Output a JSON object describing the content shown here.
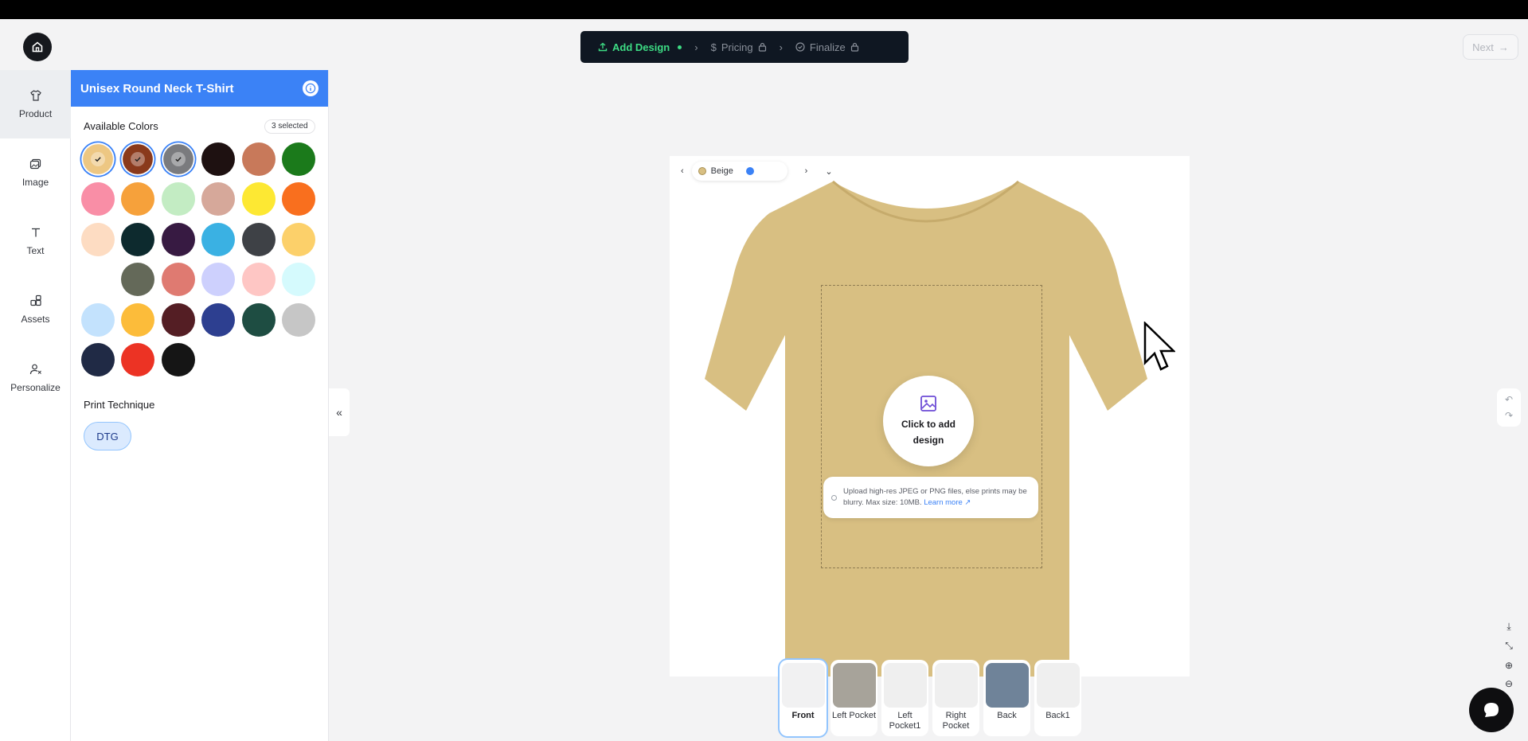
{
  "header": {
    "steps": [
      {
        "label": "Add Design",
        "icon": "upload-icon",
        "state": "active"
      },
      {
        "label": "Pricing",
        "icon": "dollar-icon",
        "state": "locked"
      },
      {
        "label": "Finalize",
        "icon": "check-circle-icon",
        "state": "locked"
      }
    ],
    "next_label": "Next"
  },
  "leftnav": {
    "items": [
      {
        "label": "Product",
        "icon": "tshirt-icon",
        "active": true
      },
      {
        "label": "Image",
        "icon": "image-icon",
        "active": false
      },
      {
        "label": "Text",
        "icon": "text-icon",
        "active": false
      },
      {
        "label": "Assets",
        "icon": "assets-icon",
        "active": false
      },
      {
        "label": "Personalize",
        "icon": "personalize-icon",
        "active": false
      }
    ]
  },
  "panel": {
    "title": "Unisex Round Neck T-Shirt",
    "colors_title": "Available Colors",
    "selected_badge": "3 selected",
    "swatches": [
      {
        "color": "#edc783",
        "selected": true
      },
      {
        "color": "#8a3a1c",
        "selected": true
      },
      {
        "color": "#7a7b7e",
        "selected": true
      },
      {
        "color": "#1e1111",
        "selected": false
      },
      {
        "color": "#c8795a",
        "selected": false
      },
      {
        "color": "#1b7a1b",
        "selected": false
      },
      {
        "color": "#f98ea6",
        "selected": false
      },
      {
        "color": "#f6a13b",
        "selected": false
      },
      {
        "color": "#c3ecc3",
        "selected": false
      },
      {
        "color": "#d6a89a",
        "selected": false
      },
      {
        "color": "#fde833",
        "selected": false
      },
      {
        "color": "#f96f1e",
        "selected": false
      },
      {
        "color": "#fddcc2",
        "selected": false
      },
      {
        "color": "#0d2a2e",
        "selected": false
      },
      {
        "color": "#371a42",
        "selected": false
      },
      {
        "color": "#3ab1e3",
        "selected": false
      },
      {
        "color": "#3e4146",
        "selected": false
      },
      {
        "color": "#fcd06a",
        "selected": false
      },
      {
        "color": "#ffffff",
        "selected": false
      },
      {
        "color": "#646959",
        "selected": false
      },
      {
        "color": "#df7a71",
        "selected": false
      },
      {
        "color": "#cdd0fd",
        "selected": false
      },
      {
        "color": "#fec6c4",
        "selected": false
      },
      {
        "color": "#d5fafd",
        "selected": false
      },
      {
        "color": "#c3e2fd",
        "selected": false
      },
      {
        "color": "#fcbc3a",
        "selected": false
      },
      {
        "color": "#541e24",
        "selected": false
      },
      {
        "color": "#2d3f90",
        "selected": false
      },
      {
        "color": "#1e4d42",
        "selected": false
      },
      {
        "color": "#c6c6c6",
        "selected": false
      },
      {
        "color": "#202a45",
        "selected": false
      },
      {
        "color": "#ec3324",
        "selected": false
      },
      {
        "color": "#151515",
        "selected": false
      }
    ],
    "print_title": "Print Technique",
    "print_option": "DTG"
  },
  "canvas": {
    "color_name": "Beige",
    "add_design_label": "Click to add design",
    "upload_note": "Upload high-res JPEG or PNG files, else prints may be blurry. Max size: 10MB.",
    "learn_more": "Learn more",
    "tshirt_color": "#d8bf82"
  },
  "views": [
    {
      "label": "Front",
      "active": true,
      "thumb": "#f1f1f2"
    },
    {
      "label": "Left Pocket",
      "active": false,
      "thumb": "#a7a39a"
    },
    {
      "label": "Left Pocket1",
      "active": false,
      "thumb": "#efefef"
    },
    {
      "label": "Right Pocket",
      "active": false,
      "thumb": "#efefef"
    },
    {
      "label": "Back",
      "active": false,
      "thumb": "#6f8399"
    },
    {
      "label": "Back1",
      "active": false,
      "thumb": "#efefef"
    }
  ]
}
